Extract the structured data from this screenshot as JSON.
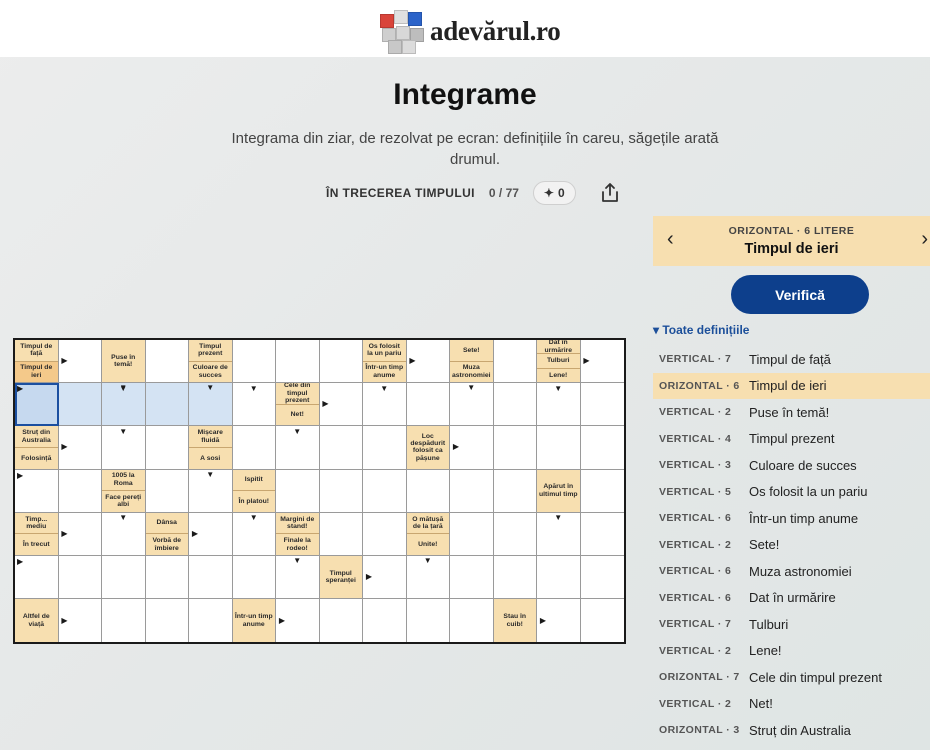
{
  "header": {
    "logo_text": "adevărul.ro"
  },
  "page": {
    "title": "Integrame",
    "subtitle": "Integrama din ziar, de rezolvat pe ecran: definițiile în careu, săgețile arată drumul.",
    "series": "ÎN TRECEREA TIMPULUI",
    "progress": "0 / 77",
    "hints": "0",
    "hint_icon": "sparkle-icon",
    "share_icon": "share-icon"
  },
  "current_clue": {
    "direction": "ORIZONTAL · 6 LITERE",
    "text": "Timpul de ieri",
    "prev": "‹",
    "next": "›"
  },
  "verify_label": "Verifică",
  "all_definitions_label": "▾ Toate definițiile",
  "definitions": [
    {
      "dir": "VERTICAL · 7",
      "text": "Timpul de față"
    },
    {
      "dir": "ORIZONTAL · 6",
      "text": "Timpul de ieri",
      "selected": true
    },
    {
      "dir": "VERTICAL · 2",
      "text": "Puse în temă!"
    },
    {
      "dir": "VERTICAL · 4",
      "text": "Timpul prezent"
    },
    {
      "dir": "VERTICAL · 3",
      "text": "Culoare de succes"
    },
    {
      "dir": "VERTICAL · 5",
      "text": "Os folosit la un pariu"
    },
    {
      "dir": "VERTICAL · 6",
      "text": "Într-un timp anume"
    },
    {
      "dir": "VERTICAL · 2",
      "text": "Sete!"
    },
    {
      "dir": "VERTICAL · 6",
      "text": "Muza astronomiei"
    },
    {
      "dir": "VERTICAL · 6",
      "text": "Dat în urmărire"
    },
    {
      "dir": "VERTICAL · 7",
      "text": "Tulburi"
    },
    {
      "dir": "VERTICAL · 2",
      "text": "Lene!"
    },
    {
      "dir": "ORIZONTAL · 7",
      "text": "Cele din timpul prezent"
    },
    {
      "dir": "VERTICAL · 2",
      "text": "Net!"
    },
    {
      "dir": "ORIZONTAL · 3",
      "text": "Struț din Australia"
    }
  ],
  "grid": {
    "rows": 7,
    "cols": 14,
    "clues": [
      {
        "r": 0,
        "c": 0,
        "parts": [
          "Timpul de față",
          "Timpul de ieri"
        ],
        "sel": 1
      },
      {
        "r": 0,
        "c": 2,
        "parts": [
          "Puse în temă!"
        ]
      },
      {
        "r": 0,
        "c": 4,
        "parts": [
          "Timpul prezent",
          "Culoare de succes"
        ]
      },
      {
        "r": 0,
        "c": 8,
        "parts": [
          "Os folosit la un pariu",
          "Într-un timp anume"
        ]
      },
      {
        "r": 0,
        "c": 10,
        "parts": [
          "Sete!",
          "Muza astronomiei"
        ]
      },
      {
        "r": 0,
        "c": 12,
        "parts": [
          "Dat în urmărire",
          "Tulburi",
          "Lene!"
        ]
      },
      {
        "r": 1,
        "c": 6,
        "parts": [
          "Cele din timpul prezent",
          "Net!"
        ]
      },
      {
        "r": 2,
        "c": 0,
        "parts": [
          "Struț din Australia",
          "Folosință"
        ]
      },
      {
        "r": 2,
        "c": 4,
        "parts": [
          "Mișcare fluidă",
          "A sosi"
        ]
      },
      {
        "r": 2,
        "c": 9,
        "parts": [
          "Loc despădurit folosit ca pășune"
        ]
      },
      {
        "r": 3,
        "c": 2,
        "parts": [
          "1005 la Roma",
          "Face pereți albi"
        ]
      },
      {
        "r": 3,
        "c": 5,
        "parts": [
          "Ispitit",
          "În platou!"
        ]
      },
      {
        "r": 3,
        "c": 12,
        "parts": [
          "Apărut în ultimul timp"
        ]
      },
      {
        "r": 4,
        "c": 0,
        "parts": [
          "Timp... mediu",
          "În trecut"
        ]
      },
      {
        "r": 4,
        "c": 3,
        "parts": [
          "Dânsa",
          "Vorbă de îmbiere"
        ]
      },
      {
        "r": 4,
        "c": 6,
        "parts": [
          "Margini de stand!",
          "Finale la rodeo!"
        ]
      },
      {
        "r": 4,
        "c": 9,
        "parts": [
          "O mătușă de la țară",
          "Unite!"
        ]
      },
      {
        "r": 5,
        "c": 7,
        "parts": [
          "Timpul speranței"
        ]
      },
      {
        "r": 6,
        "c": 0,
        "parts": [
          "Altfel de viață"
        ]
      },
      {
        "r": 6,
        "c": 5,
        "parts": [
          "Într-un timp anume"
        ]
      },
      {
        "r": 6,
        "c": 11,
        "parts": [
          "Stau în cuib!"
        ]
      }
    ]
  }
}
